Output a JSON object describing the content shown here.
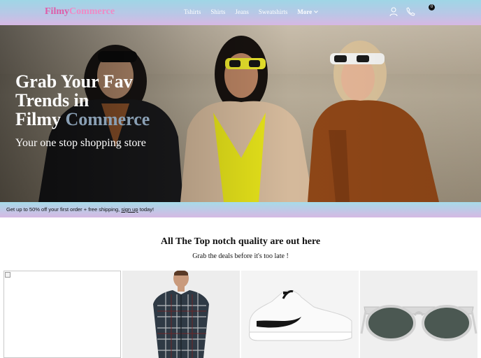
{
  "navbar": {
    "brand_part1": "Filmy",
    "brand_part2": "Commerce",
    "links": [
      "Tshirts",
      "Shirts",
      "Jeans",
      "Sweatshirts"
    ],
    "more_label": "More",
    "cart_count": "0",
    "icons": [
      "user-icon",
      "phone-icon",
      "cart-icon"
    ]
  },
  "hero": {
    "title_line1": "Grab Your Fav",
    "title_line2": "Trends in",
    "title_line3_word": "Filmy",
    "title_line3_accent": "Commerce",
    "subtitle": "Your one stop shopping store"
  },
  "promo": {
    "text_before": "Get up to 50% off your first order + free shipping,",
    "link": "sign up",
    "text_after": "today!"
  },
  "section": {
    "title": "All The Top notch quality are out here",
    "subtitle": "Grab the deals before it's too late !"
  },
  "products": [
    {
      "name": "broken-image"
    },
    {
      "name": "checked-shirt"
    },
    {
      "name": "white-sneaker"
    },
    {
      "name": "sunglasses"
    }
  ],
  "colors": {
    "brand_pink": "#e05aa8",
    "accent_blue": "#8aa0b5",
    "nav_gradient_top": "#9fd6e6",
    "nav_gradient_bottom": "#d7b8e4"
  }
}
